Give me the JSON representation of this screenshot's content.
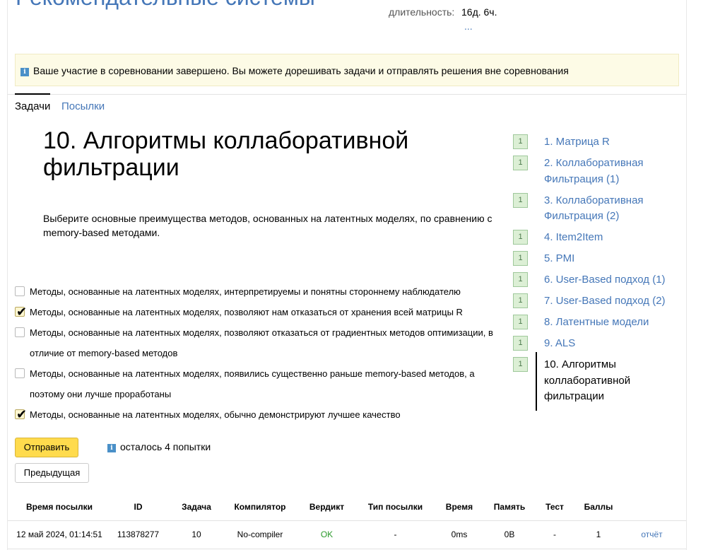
{
  "contest": {
    "title": "Рекомендательные системы",
    "duration_label": "длительность:",
    "duration_value": "16д. 6ч.",
    "more_link": "..."
  },
  "notice": {
    "text": "Ваше участие в соревновании завершено. Вы можете дорешивать задачи и отправлять решения вне соревнования"
  },
  "tabs": [
    {
      "label": "Задачи",
      "active": true
    },
    {
      "label": "Посылки",
      "active": false
    }
  ],
  "problem": {
    "title": "10. Алгоритмы коллаборативной фильтрации",
    "description": "Выберите основные преимущества методов, основанных на латентных моделях, по сравнению с memory-based методами.",
    "options": [
      {
        "text": "Методы, основанные на латентных моделях, интерпретируемы и понятны стороннему наблюдателю",
        "checked": false
      },
      {
        "text": "Методы, основанные на латентных моделях, позволяют нам отказаться от хранения всей матрицы R",
        "checked": true
      },
      {
        "text": "Методы, основанные на латентных моделях, позволяют отказаться от градиентных методов оптимизации, в отличие от memory-based методов",
        "checked": false
      },
      {
        "text": "Методы, основанные на латентных моделях, появились существенно раньше memory-based методов, а поэтому они лучше проработаны",
        "checked": false
      },
      {
        "text": "Методы, основанные на латентных моделях, обычно демонстрируют лучшее качество",
        "checked": true
      }
    ]
  },
  "actions": {
    "submit": "Отправить",
    "attempts_left": "осталось 4 попытки",
    "previous": "Предыдущая"
  },
  "problem_list": [
    {
      "badge": "1",
      "label": "1. Матрица R"
    },
    {
      "badge": "1",
      "label": "2. Коллаборативная Фильтрация (1)"
    },
    {
      "badge": "1",
      "label": "3. Коллаборативная Фильтрация (2)"
    },
    {
      "badge": "1",
      "label": "4. Item2Item"
    },
    {
      "badge": "1",
      "label": "5. PMI"
    },
    {
      "badge": "1",
      "label": "6. User-Based подход (1)"
    },
    {
      "badge": "1",
      "label": "7. User-Based подход (2)"
    },
    {
      "badge": "1",
      "label": "8. Латентные модели"
    },
    {
      "badge": "1",
      "label": "9. ALS"
    },
    {
      "badge": "1",
      "label": "10. Алгоритмы коллаборативной фильтрации",
      "current": true
    }
  ],
  "submissions": {
    "headers": [
      "Время посылки",
      "ID",
      "Задача",
      "Компилятор",
      "Вердикт",
      "Тип посылки",
      "Время",
      "Память",
      "Тест",
      "Баллы",
      ""
    ],
    "rows": [
      [
        "12 май 2024, 01:14:51",
        "113878277",
        "10",
        "No-compiler",
        "OK",
        "-",
        "0ms",
        "0B",
        "-",
        "1",
        "отчёт"
      ]
    ]
  },
  "colors": {
    "link": "#4577b8",
    "notice_bg": "#fdfbe6",
    "submit_button": "#ffdb4d",
    "badge_bg": "#dcefd5",
    "verdict_ok": "#2b9a2b"
  }
}
